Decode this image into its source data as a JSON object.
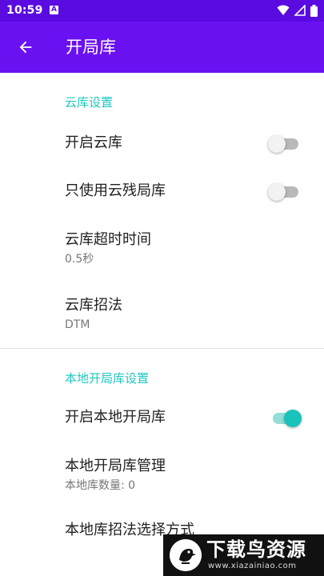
{
  "status_bar": {
    "time": "10:59",
    "notification_badge": "A",
    "icons": [
      "wifi-icon",
      "signal-icon",
      "battery-icon"
    ]
  },
  "app_bar": {
    "title": "开局库",
    "back_icon": "arrow-back-icon",
    "background": "#6a11f2"
  },
  "cloud_section": {
    "header": "云库设置",
    "enable_cloud": {
      "title": "开启云库",
      "enabled": false
    },
    "endgame_only": {
      "title": "只使用云残局库",
      "enabled": false
    },
    "timeout": {
      "title": "云库超时时间",
      "summary": "0.5秒"
    },
    "move_method": {
      "title": "云库招法",
      "summary": "DTM"
    }
  },
  "local_section": {
    "header": "本地开局库设置",
    "enable_local": {
      "title": "开启本地开局库",
      "enabled": true
    },
    "management": {
      "title": "本地开局库管理",
      "summary": "本地库数量: 0"
    },
    "move_selection": {
      "title": "本地库招法选择方式"
    }
  },
  "watermark": {
    "title": "下载鸟资源",
    "url": "www.xiazainiao.com"
  },
  "colors": {
    "accent": "#1ec8c0",
    "status_bar": "#5a0be0"
  }
}
